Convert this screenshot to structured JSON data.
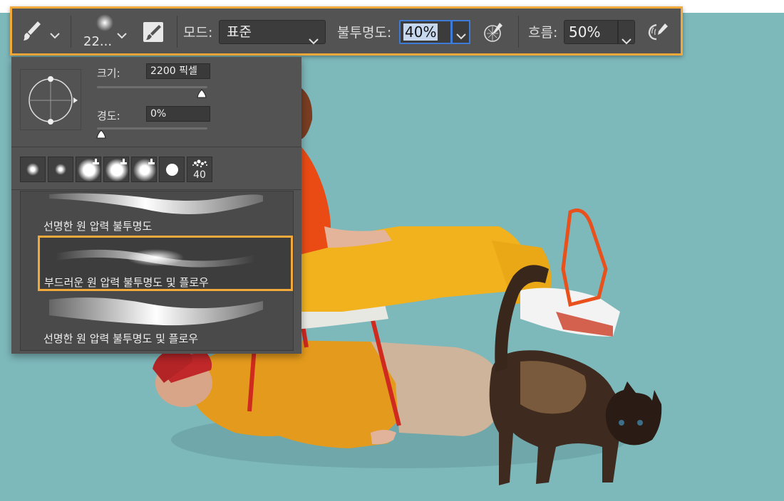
{
  "options_bar": {
    "brush_size": "22...",
    "mode_label": "모드:",
    "mode_value": "표준",
    "opacity_label": "불투명도:",
    "opacity_value": "40%",
    "flow_label": "흐름:",
    "flow_value": "50%",
    "icons": [
      "brush-tool-icon",
      "brush-preset-icon",
      "brush-settings-icon",
      "pressure-opacity-icon",
      "airbrush-icon"
    ]
  },
  "brush_panel": {
    "size_label": "크기:",
    "size_value": "2200 픽셀",
    "size_slider": 0.95,
    "hardness_label": "경도:",
    "hardness_value": "0%",
    "hardness_slider": 0.0,
    "recent_tip_count": "40",
    "presets": [
      {
        "name": "선명한 원 압력 불투명도",
        "selected": false
      },
      {
        "name": "부드러운 원 압력 불투명도 및 플로우",
        "selected": true
      },
      {
        "name": "선명한 원 압력 불투명도 및 플로우",
        "selected": false
      }
    ]
  },
  "colors": {
    "highlight": "#f2a93b",
    "panel_bg": "#535353",
    "canvas_bg": "#7db8bb"
  }
}
